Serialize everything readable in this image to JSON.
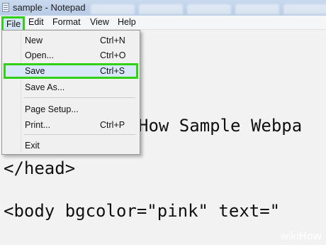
{
  "window": {
    "title": "sample - Notepad"
  },
  "menubar": {
    "file": "File",
    "edit": "Edit",
    "format": "Format",
    "view": "View",
    "help": "Help"
  },
  "file_menu": {
    "items": [
      {
        "label": "New",
        "shortcut": "Ctrl+N"
      },
      {
        "label": "Open...",
        "shortcut": "Ctrl+O"
      },
      {
        "label": "Save",
        "shortcut": "Ctrl+S",
        "highlighted": true
      },
      {
        "label": "Save As...",
        "shortcut": ""
      },
      {
        "label": "Page Setup...",
        "shortcut": ""
      },
      {
        "label": "Print...",
        "shortcut": "Ctrl+P"
      },
      {
        "label": "Exit",
        "shortcut": ""
      }
    ]
  },
  "editor": {
    "lines": [
      "How Sample Webpa",
      "</head>",
      "<body bgcolor=\"pink\" text=\""
    ]
  },
  "watermark": {
    "part1": "wiki",
    "part2": "How"
  },
  "colors": {
    "highlight_outline": "#33d017",
    "selection_fill": "#d8e8f8",
    "titlebar": "#c2d4ec"
  }
}
